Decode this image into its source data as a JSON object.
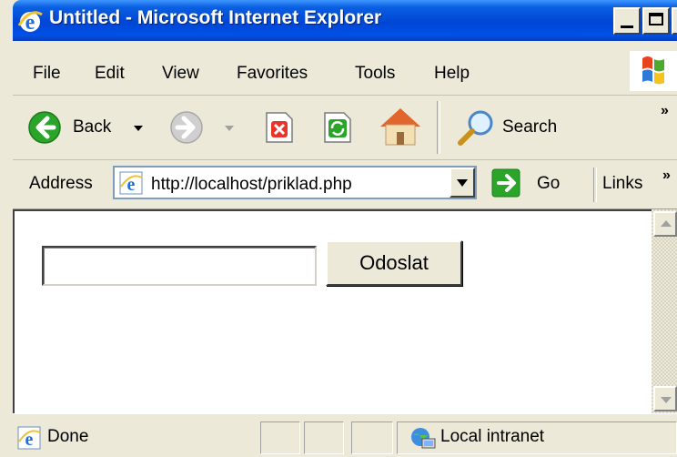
{
  "window": {
    "title": "Untitled - Microsoft Internet Explorer"
  },
  "menu": {
    "items": [
      "File",
      "Edit",
      "View",
      "Favorites",
      "Tools",
      "Help"
    ]
  },
  "toolbar": {
    "back_label": "Back",
    "search_label": "Search",
    "overflow": "»",
    "icons": [
      "back-icon",
      "forward-icon",
      "stop-icon",
      "refresh-icon",
      "home-icon",
      "search-icon"
    ]
  },
  "address": {
    "label": "Address",
    "value": "http://localhost/priklad.php",
    "go_label": "Go",
    "links_label": "Links",
    "overflow": "»"
  },
  "page": {
    "input_value": "",
    "button_label": "Odoslat"
  },
  "status": {
    "text": "Done",
    "zone": "Local intranet"
  },
  "colors": {
    "titlebar": "#0046d5",
    "chrome": "#ece9d8",
    "go_green": "#2aa52a"
  }
}
